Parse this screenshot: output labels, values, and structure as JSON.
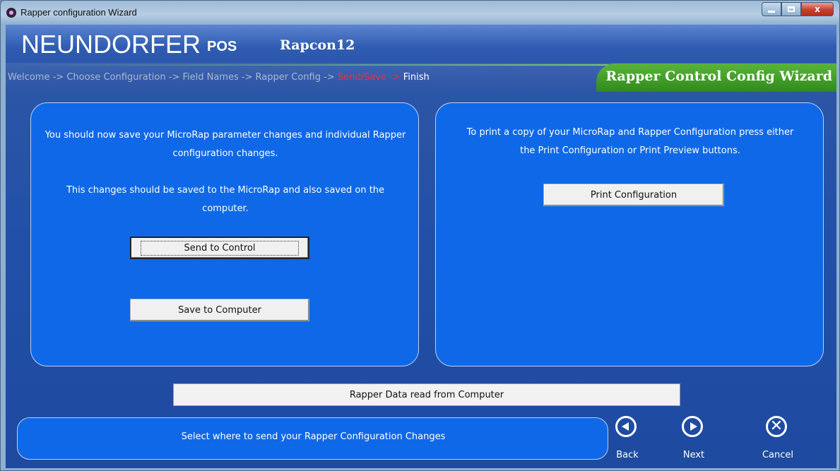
{
  "window": {
    "title": "Rapper configuration Wizard",
    "controls": {
      "close_glyph": "x"
    }
  },
  "header": {
    "brand": "NEUNDORFER",
    "product": "POS",
    "config_name": "Rapcon12",
    "wizard_title": "Rapper Control Config Wizard"
  },
  "breadcrumb": {
    "steps_before": "Welcome -> Choose Configuration -> Field Names -> Rapper Config -> ",
    "current": "Send/Save ->",
    "after": " Finish"
  },
  "left_panel": {
    "text_1": "You should now save your MicroRap parameter changes and individual Rapper configuration changes.",
    "text_2": "This changes should be saved to the MicroRap and also saved on the computer.",
    "send_button": "Send to Control",
    "save_button": "Save to Computer"
  },
  "right_panel": {
    "text": "To print a copy of your MicroRap and Rapper Configuration press either the Print Configuration or Print Preview buttons.",
    "print_button": "Print Configuration"
  },
  "status_field": "Rapper Data read from Computer",
  "message": "Select where to send your Rapper Configuration Changes",
  "nav": {
    "back": "Back",
    "next": "Next",
    "cancel": "Cancel"
  },
  "colors": {
    "panel_blue": "#0f68e8",
    "wizard_green": "#3d9a26",
    "current_step_red": "#e8323a"
  }
}
